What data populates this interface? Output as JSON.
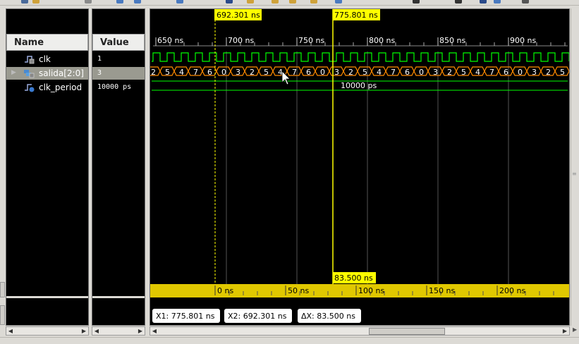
{
  "columns": {
    "name_header": "Name",
    "value_header": "Value"
  },
  "signals": [
    {
      "name": "clk",
      "value": "1",
      "kind": "bit-icon",
      "selected": false
    },
    {
      "name": "salida[2:0]",
      "value": "3",
      "kind": "bus-icon",
      "selected": true
    },
    {
      "name": "clk_period",
      "value": "10000 ps",
      "kind": "param-icon",
      "selected": false
    }
  ],
  "time_axis": {
    "ticks": [
      "650 ns",
      "700 ns",
      "750 ns",
      "800 ns",
      "850 ns",
      "900 ns"
    ]
  },
  "bus_values": [
    "2",
    "5",
    "4",
    "7",
    "6",
    "0",
    "3",
    "2",
    "5",
    "4",
    "7",
    "6",
    "0",
    "3",
    "2",
    "5",
    "4",
    "7",
    "6",
    "0",
    "3",
    "2",
    "5",
    "4",
    "7",
    "6",
    "0",
    "3",
    "2",
    "5"
  ],
  "clk_period_label": "10000 ps",
  "cursors": {
    "x1": {
      "time": "775.801 ns",
      "time_ns": 775.801
    },
    "x2": {
      "time": "692.301 ns",
      "time_ns": 692.301
    }
  },
  "delta_label": "83.500 ns",
  "delta_axis": {
    "ticks": [
      "0 ns",
      "50 ns",
      "100 ns",
      "150 ns",
      "200 ns"
    ]
  },
  "readouts": {
    "x1": "X1: 775.801 ns",
    "x2": "X2: 692.301 ns",
    "dx": "ΔX: 83.500 ns"
  },
  "colors": {
    "clk_wave": "#00ff00",
    "bus_wave": "#ff8c00",
    "cursor": "#ffff00",
    "marker_bar": "#e0c800",
    "grid": "#555555"
  }
}
